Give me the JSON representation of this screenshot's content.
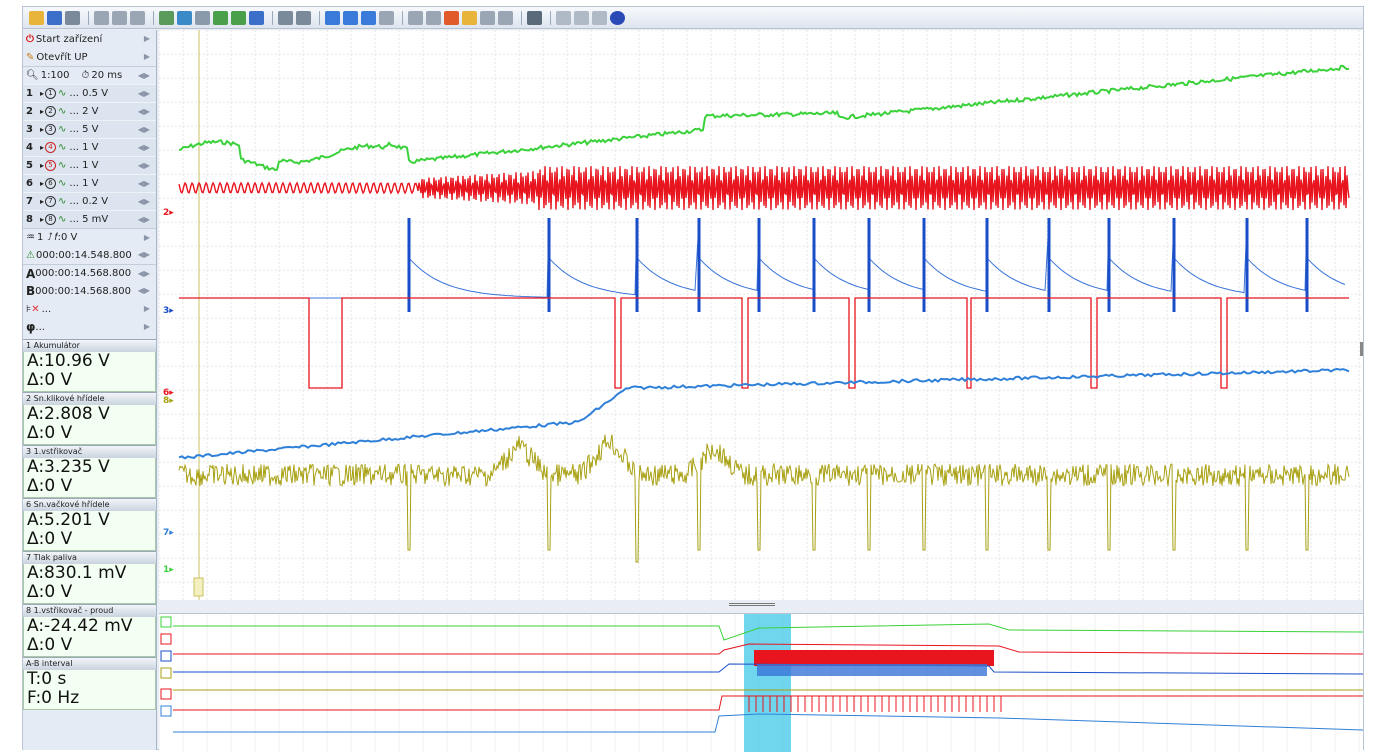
{
  "menu": {
    "start_label": "Start zařízení",
    "open_label": "Otevřít UP",
    "zoom_label": "1:100",
    "timebase_label": "20 ms"
  },
  "channels": [
    {
      "num": "1",
      "circle": "1",
      "disabled": false,
      "scale": "... 0.5 V"
    },
    {
      "num": "2",
      "circle": "2",
      "disabled": false,
      "scale": "... 2 V"
    },
    {
      "num": "3",
      "circle": "3",
      "disabled": false,
      "scale": "... 5 V"
    },
    {
      "num": "4",
      "circle": "4",
      "disabled": true,
      "scale": "... 1 V"
    },
    {
      "num": "5",
      "circle": "5",
      "disabled": true,
      "scale": "... 1 V"
    },
    {
      "num": "6",
      "circle": "6",
      "disabled": false,
      "scale": "... 1 V"
    },
    {
      "num": "7",
      "circle": "7",
      "disabled": false,
      "scale": "... 0.2 V"
    },
    {
      "num": "8",
      "circle": "8",
      "disabled": false,
      "scale": "... 5 mV"
    }
  ],
  "trigger": {
    "channel": "1",
    "level": "0 V"
  },
  "time_position": "000:00:14.548.800",
  "cursor_a": "000:00:14.568.800",
  "cursor_b": "000:00:14.568.800",
  "cursor_tool_label": "...",
  "phase_label": "...",
  "measurements": [
    {
      "title": "1 Akumulátor",
      "value": "A:10.96 V",
      "delta": "Δ:0 V"
    },
    {
      "title": "2 Sn.klikové hřídele",
      "value": "A:2.808 V",
      "delta": "Δ:0 V"
    },
    {
      "title": "3 1.vstřikovač",
      "value": "A:3.235 V",
      "delta": "Δ:0 V"
    },
    {
      "title": "6 Sn.vačkové hřídele",
      "value": "A:5.201 V",
      "delta": "Δ:0 V"
    },
    {
      "title": "7 Tlak paliva",
      "value": "A:830.1 mV",
      "delta": "Δ:0 V"
    },
    {
      "title": "8 1.vstřikovač - proud",
      "value": "A:-24.42 mV",
      "delta": "Δ:0 V"
    },
    {
      "title": "A-B interval",
      "value": "T:0 s",
      "delta": "F:0 Hz"
    }
  ],
  "channel_markers": {
    "ch2": "2",
    "ch3": "3",
    "ch6": "6",
    "ch8": "8",
    "ch7": "7",
    "ch1": "1"
  },
  "colors": {
    "ch1": "#3ad13a",
    "ch2": "#e8141e",
    "ch3": "#1a4ec8",
    "ch6": "#e8141e",
    "ch7": "#2f80d8",
    "ch8": "#a8a012",
    "cursor": "#c8c060",
    "highlight": "#40c8e8"
  }
}
